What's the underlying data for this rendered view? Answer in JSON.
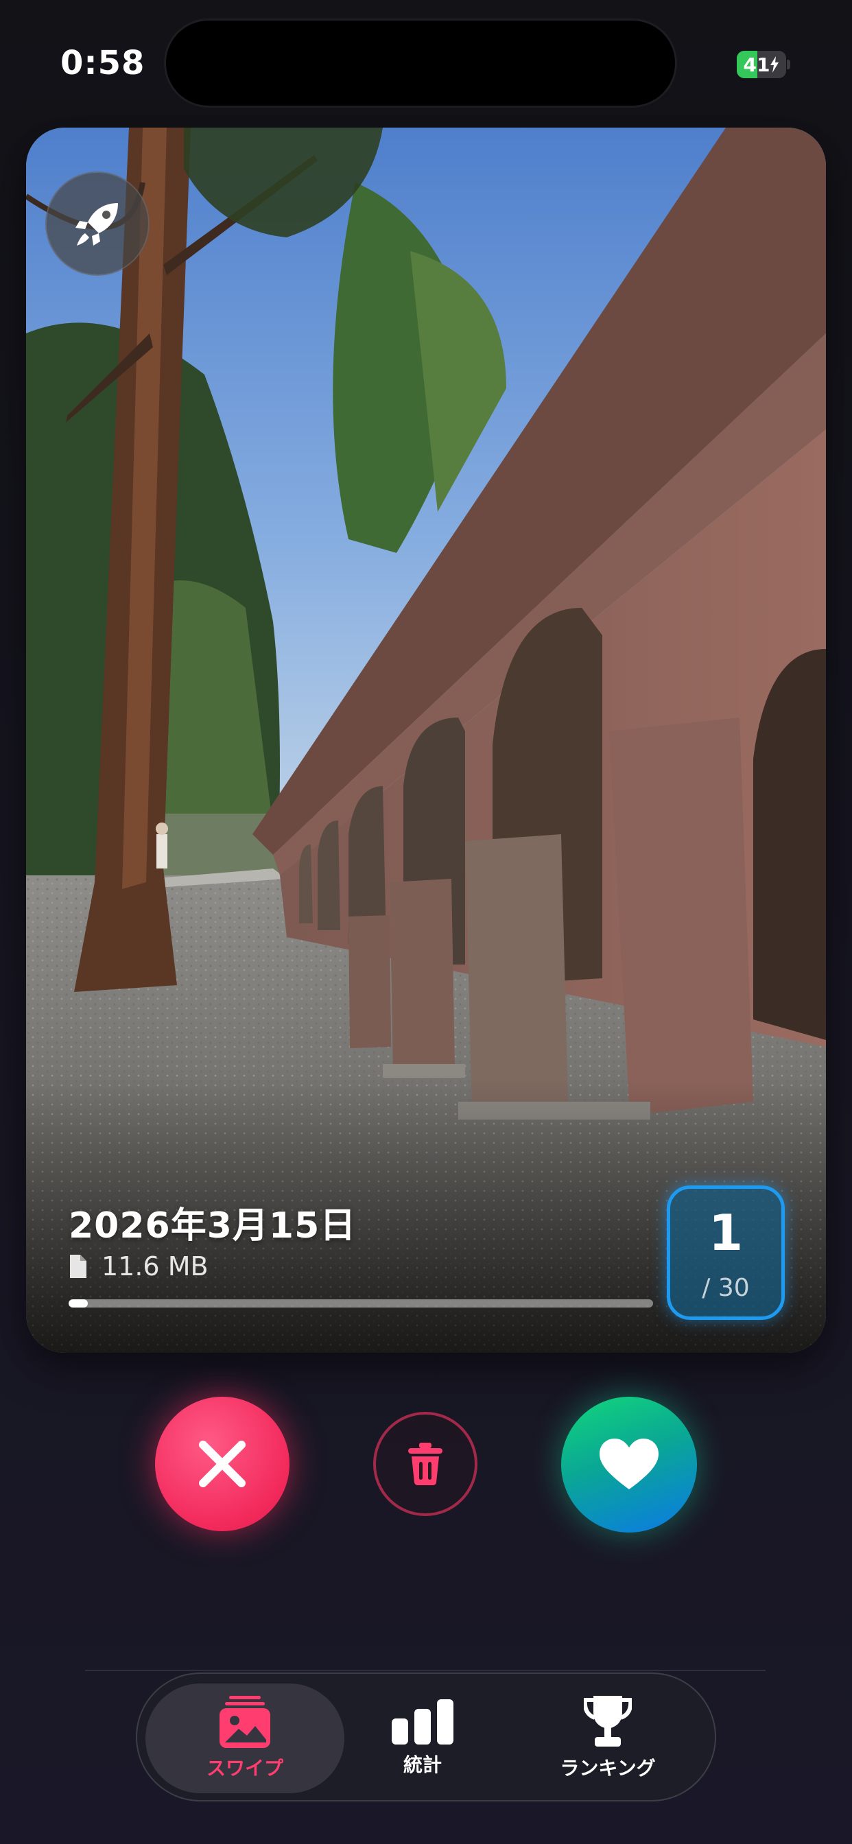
{
  "status_bar": {
    "time": "0:58",
    "battery_level": "41",
    "battery_fraction": 0.41,
    "battery_charging": true
  },
  "photo_card": {
    "boost_icon": "rocket-icon",
    "date": "2026年3月15日",
    "file_icon": "document-icon",
    "file_size": "11.6 MB",
    "progress_fraction": 0.0333,
    "counter": {
      "current": "1",
      "total": "/ 30"
    }
  },
  "actions": {
    "reject_icon": "close-icon",
    "delete_icon": "trash-icon",
    "like_icon": "heart-icon"
  },
  "tab_bar": {
    "active": "swipe",
    "tabs": [
      {
        "id": "swipe",
        "label": "スワイプ",
        "icon": "photo-stack-icon"
      },
      {
        "id": "stats",
        "label": "統計",
        "icon": "bar-chart-icon"
      },
      {
        "id": "ranking",
        "label": "ランキング",
        "icon": "trophy-icon"
      }
    ]
  },
  "colors": {
    "reject": "#f2295b",
    "like_start": "#12d67a",
    "like_end": "#0b79e6",
    "badge_border": "#1e9bf0",
    "active_tab": "#ff3d6e",
    "battery": "#34c759"
  }
}
